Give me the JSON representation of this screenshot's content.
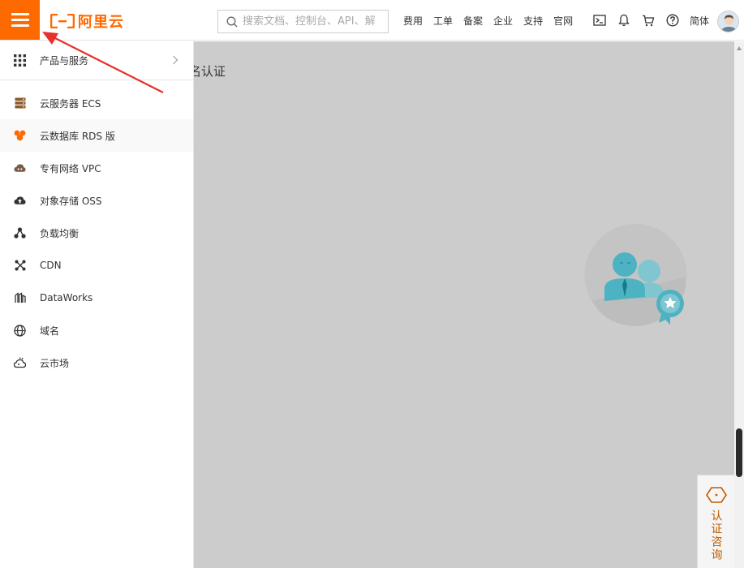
{
  "header": {
    "logo_text": "阿里云",
    "search_placeholder": "搜索文档、控制台、API、解",
    "nav": [
      "费用",
      "工单",
      "备案",
      "企业",
      "支持",
      "官网"
    ],
    "lang": "简体"
  },
  "sidebar": {
    "products_label": "产品与服务",
    "items": [
      {
        "label": "云服务器 ECS",
        "icon": "server-icon"
      },
      {
        "label": "云数据库 RDS 版",
        "icon": "database-icon"
      },
      {
        "label": "专有网络 VPC",
        "icon": "cloud-network-icon"
      },
      {
        "label": "对象存储 OSS",
        "icon": "cloud-storage-icon"
      },
      {
        "label": "负载均衡",
        "icon": "load-balancer-icon"
      },
      {
        "label": "CDN",
        "icon": "cdn-icon"
      },
      {
        "label": "DataWorks",
        "icon": "dataworks-icon"
      },
      {
        "label": "域名",
        "icon": "globe-icon"
      },
      {
        "label": "云市场",
        "icon": "market-icon"
      }
    ]
  },
  "main": {
    "title_partial": "名认证"
  },
  "consult": {
    "label": "认证咨询"
  },
  "colors": {
    "brand": "#ff6a00",
    "overlay_gray": "#cccccc",
    "consult_text": "#c45a00",
    "illustration_teal": "#4db3c2"
  }
}
